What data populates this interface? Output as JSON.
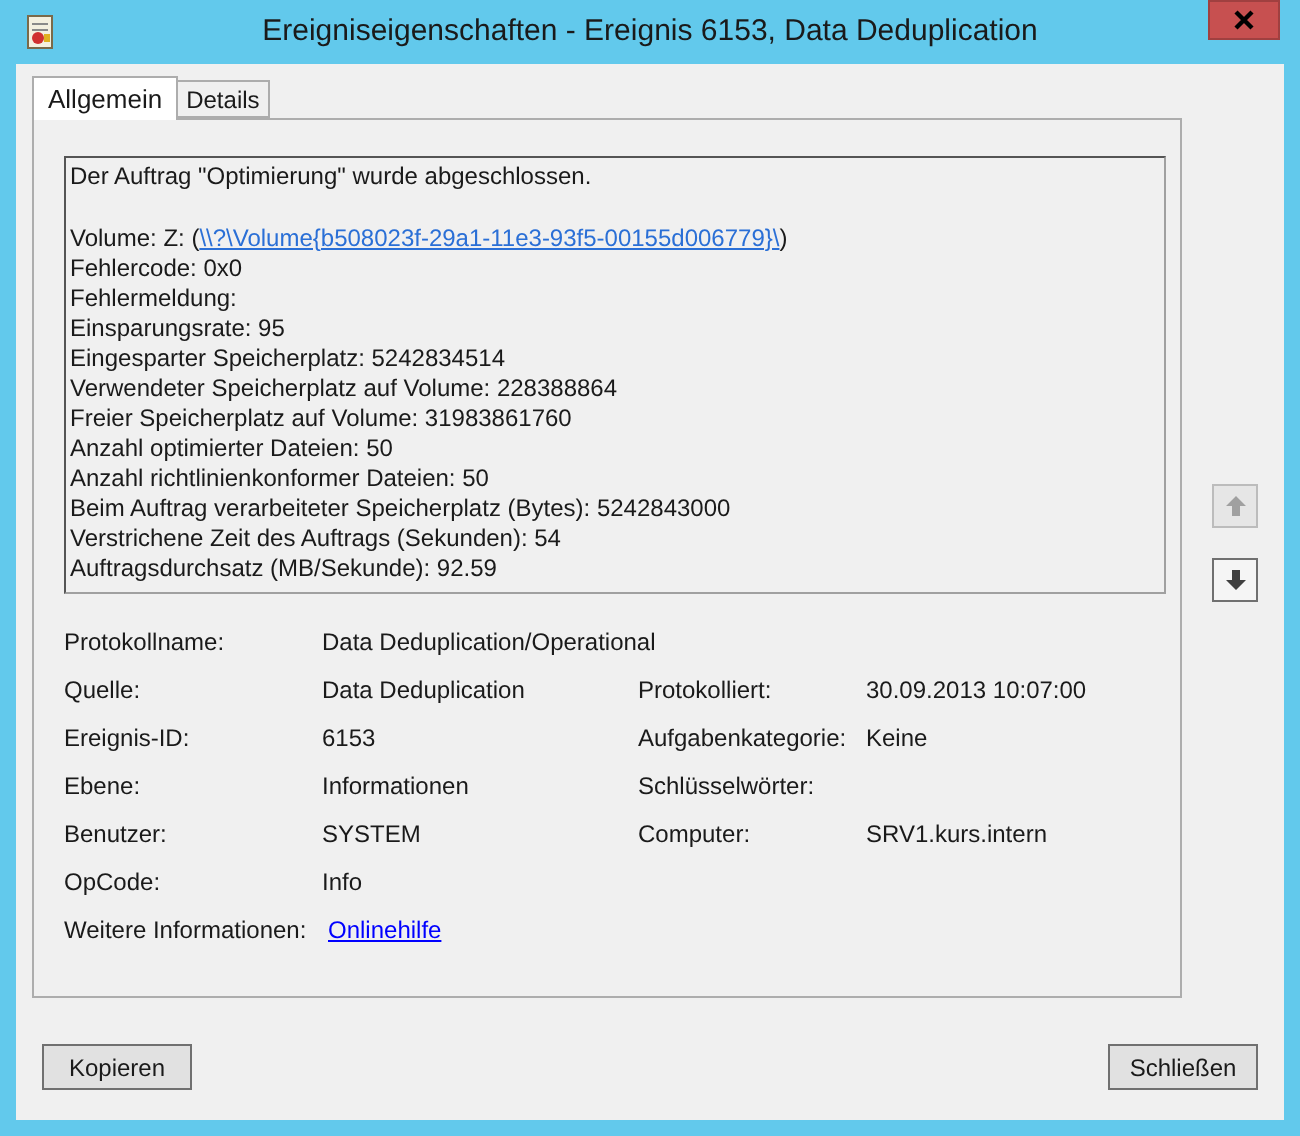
{
  "window": {
    "title": "Ereigniseigenschaften - Ereignis 6153, Data Deduplication"
  },
  "tabs": [
    {
      "label": "Allgemein",
      "selected": true
    },
    {
      "label": "Details",
      "selected": false
    }
  ],
  "message": {
    "summary": "Der Auftrag \"Optimierung\" wurde abgeschlossen.",
    "lines": [
      {
        "kind": "link",
        "prefix": "Volume: Z: (",
        "link": "\\\\?\\Volume{b508023f-29a1-11e3-93f5-00155d006779}\\",
        "suffix": ")"
      },
      {
        "kind": "text",
        "text": "Fehlercode: 0x0"
      },
      {
        "kind": "text",
        "text": "Fehlermeldung:"
      },
      {
        "kind": "text",
        "text": "Einsparungsrate: 95"
      },
      {
        "kind": "text",
        "text": "Eingesparter Speicherplatz: 5242834514"
      },
      {
        "kind": "text",
        "text": "Verwendeter Speicherplatz auf Volume: 228388864"
      },
      {
        "kind": "text",
        "text": "Freier Speicherplatz auf Volume: 31983861760"
      },
      {
        "kind": "text",
        "text": "Anzahl optimierter Dateien: 50"
      },
      {
        "kind": "text",
        "text": "Anzahl richtlinienkonformer Dateien: 50"
      },
      {
        "kind": "text",
        "text": "Beim Auftrag verarbeiteter Speicherplatz (Bytes): 5242843000"
      },
      {
        "kind": "text",
        "text": "Verstrichene Zeit des Auftrags (Sekunden): 54"
      },
      {
        "kind": "text",
        "text": "Auftragsdurchsatz (MB/Sekunde): 92.59"
      }
    ]
  },
  "scroll_buttons": [
    {
      "kind": "up",
      "disabled": true
    },
    {
      "kind": "down",
      "disabled": false
    }
  ],
  "properties": [
    {
      "left": {
        "label": "Protokollname:",
        "value": "Data Deduplication/Operational"
      }
    },
    {
      "left": {
        "label": "Quelle:",
        "value": "Data Deduplication"
      },
      "right": {
        "label": "Protokolliert:",
        "value": "30.09.2013 10:07:00"
      }
    },
    {
      "left": {
        "label": "Ereignis-ID:",
        "value": "6153"
      },
      "right": {
        "label": "Aufgabenkategorie:",
        "value": "Keine"
      }
    },
    {
      "left": {
        "label": "Ebene:",
        "value": "Informationen"
      },
      "right": {
        "label": "Schlüsselwörter:"
      }
    },
    {
      "left": {
        "label": "Benutzer:",
        "value": "SYSTEM"
      },
      "right": {
        "label": "Computer:",
        "value": "SRV1.kurs.intern"
      }
    },
    {
      "left": {
        "label": "OpCode:",
        "value": "Info"
      }
    },
    {
      "left": {
        "label": "Weitere Informationen:",
        "value": "Onlinehilfe",
        "kind": "link"
      }
    }
  ],
  "buttons": [
    "Kopieren",
    "Schließen"
  ]
}
